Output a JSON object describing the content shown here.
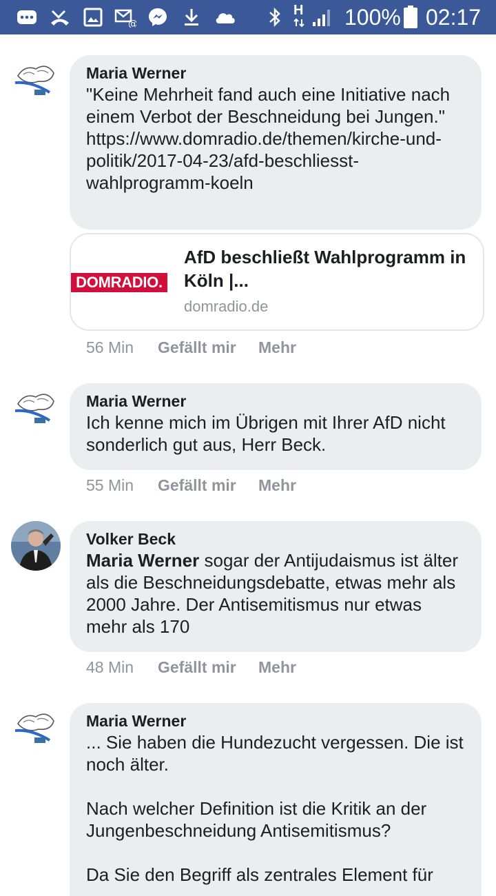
{
  "status_bar": {
    "battery": "100%",
    "time": "02:17",
    "network_label": "H",
    "icons": [
      "chat-icon",
      "missed-call-icon",
      "gallery-icon",
      "email-icon",
      "messenger-icon",
      "download-icon",
      "cloud-icon",
      "bluetooth-icon",
      "signal-icon",
      "battery-icon"
    ]
  },
  "comments": [
    {
      "author": "Maria Werner",
      "text": "\"Keine Mehrheit fand auch eine Initiative nach einem Verbot der Beschneidung bei Jungen.\"",
      "link": "https://www.domradio.de/themen/kirche-und-politik/2017-04-23/afd-beschliesst-wahlprogramm-koeln",
      "preview": {
        "logo": "DOMRADIO.",
        "title": "AfD beschließt Wahlprogramm in Köln |...",
        "domain": "domradio.de"
      },
      "time": "56 Min",
      "like": "Gefällt mir",
      "more": "Mehr"
    },
    {
      "author": "Maria Werner",
      "text": "Ich kenne mich im Übrigen mit Ihrer AfD nicht sonderlich gut aus, Herr Beck.",
      "time": "55 Min",
      "like": "Gefällt mir",
      "more": "Mehr"
    },
    {
      "author": "Volker Beck",
      "mention": "Maria Werner",
      "text": " sogar der Antijudaismus ist älter als die Beschneidungsdebatte, etwas mehr als 2000 Jahre. Der Antisemitismus nur etwas mehr als 170",
      "time": "48 Min",
      "like": "Gefällt mir",
      "more": "Mehr"
    },
    {
      "author": "Maria Werner",
      "text": "... Sie haben die Hundezucht vergessen. Die ist noch älter.\n\nNach welcher Definition ist die Kritik an der Jungenbeschneidung Antisemitismus?\n\nDa Sie den Begriff als zentrales Element für"
    }
  ]
}
